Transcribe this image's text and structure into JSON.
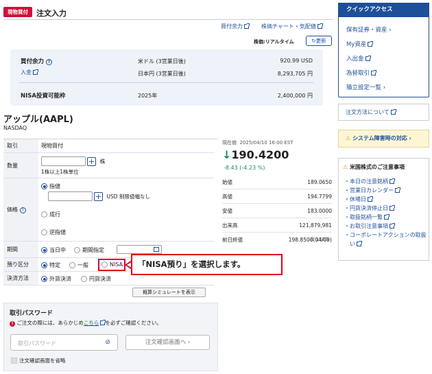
{
  "header": {
    "badge": "現物買付",
    "title": "注文入力",
    "link_buying_power": "買付余力",
    "link_chart": "株価チャート・気配値",
    "price_realtime_label": "株価:リアルタイム",
    "refresh_label": "更新"
  },
  "summary": {
    "buying_power_label": "買付余力",
    "deposit_label": "入金",
    "rows": [
      {
        "label": "米ドル (3営業日後)",
        "value": "920.99 USD"
      },
      {
        "label": "日本円 (3営業日後)",
        "value": "8,293,705 円"
      }
    ],
    "nisa_label": "NISA投資可能枠",
    "nisa_year": "2025年",
    "nisa_value": "2,400,000 円"
  },
  "stock": {
    "name": "アップル(AAPL)",
    "market": "NASDAQ",
    "current_label": "現在値",
    "datetime": "2025/04/10 16:00 EST",
    "price": "190.4200",
    "change": "-8.43 (-4.23 %)",
    "details": [
      {
        "label": "始値",
        "value": "189.0650"
      },
      {
        "label": "高値",
        "value": "194.7799"
      },
      {
        "label": "安値",
        "value": "183.0000"
      },
      {
        "label": "出来高",
        "value": "121,879,981"
      },
      {
        "label": "前日終値",
        "value": "198.8500(04/09)"
      }
    ],
    "credit": "© LSEG"
  },
  "form": {
    "trade_label": "取引",
    "trade_value": "現物買付",
    "qty_label": "数量",
    "qty_unit": "株",
    "qty_note": "1株以上1株単位",
    "price_label": "価格",
    "opt_limit": "指値",
    "limit_suffix": "USD 制限値幅なし",
    "opt_market": "成行",
    "opt_stop": "逆指値",
    "period_label": "期間",
    "opt_today": "当日中",
    "opt_period": "期間指定",
    "account_label": "預り区分",
    "opt_specific": "特定",
    "opt_general": "一般",
    "opt_nisa": "NISA",
    "settle_label": "決済方法",
    "opt_foreign": "外貨決済",
    "opt_yen": "円貨決済",
    "sim_button": "概算シミュレートを表示"
  },
  "callout": "「NISA預り」を選択します。",
  "password": {
    "title": "取引パスワード",
    "note_pre": "ご注文の際には、あらかじめ",
    "note_link": "こちら",
    "note_post": "を必ずご確認ください。",
    "placeholder": "取引パスワード",
    "confirm_button": "注文確認画面へ",
    "skip_label": "注文確認画面を省略"
  },
  "sidebar": {
    "quick_title": "クイックアクセス",
    "quick_links": [
      "保有証券・資産",
      "My資産",
      "入出金",
      "為替取引",
      "積立設定一覧"
    ],
    "order_method": "注文方法について",
    "system_fault": "システム障害時の対応",
    "notice_title": "米国株式のご注意事項",
    "notices": [
      "本日の注意銘柄",
      "営業日カレンダー",
      "休場日",
      "円貨決済停止日",
      "取扱銘柄一覧",
      "お取引注意事項",
      "コーポレートアクションの取扱い"
    ]
  },
  "colors": {
    "accent": "#1d4f9a",
    "badge": "#d0103a",
    "highlight": "#e0001a"
  }
}
